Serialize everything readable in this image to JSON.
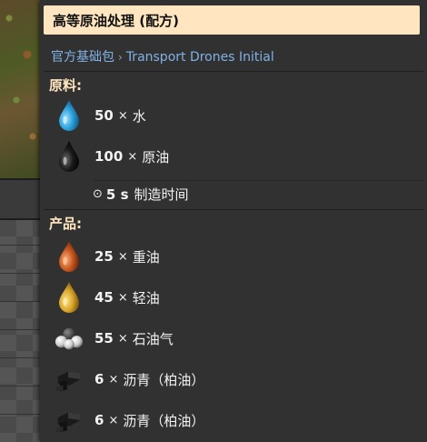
{
  "tooltip": {
    "title": "高等原油处理 (配方)",
    "breadcrumb": {
      "mod": "官方基础包",
      "separator": "›",
      "source": "Transport Drones Initial"
    }
  },
  "ingredients": {
    "label": "原料:",
    "items": [
      {
        "amount": "50",
        "times": "×",
        "name": "水",
        "icon": "water-drop-icon",
        "color": "#2a9fd8"
      },
      {
        "amount": "100",
        "times": "×",
        "name": "原油",
        "icon": "crude-oil-drop-icon",
        "color": "#1a1a1a"
      }
    ],
    "craft_time": {
      "icon": "clock-icon",
      "icon_glyph": "⊙",
      "seconds": "5 s",
      "label": "制造时间"
    }
  },
  "products": {
    "label": "产品:",
    "items": [
      {
        "amount": "25",
        "times": "×",
        "name": "重油",
        "icon": "heavy-oil-drop-icon",
        "color": "#c4561e"
      },
      {
        "amount": "45",
        "times": "×",
        "name": "轻油",
        "icon": "light-oil-drop-icon",
        "color": "#d8a52a"
      },
      {
        "amount": "55",
        "times": "×",
        "name": "石油气",
        "icon": "petroleum-gas-icon",
        "color": "#e6e6e6"
      },
      {
        "amount": "6",
        "times": "×",
        "name": "沥青（柏油）",
        "icon": "asphalt-icon",
        "color": "#222222"
      },
      {
        "amount": "6",
        "times": "×",
        "name": "沥青（柏油）",
        "icon": "asphalt-icon",
        "color": "#222222"
      }
    ]
  },
  "colors": {
    "title_bg": "#ffe6c0",
    "section_label": "#ffe6c0",
    "link": "#7fb2e6",
    "panel_bg": "#313131"
  }
}
